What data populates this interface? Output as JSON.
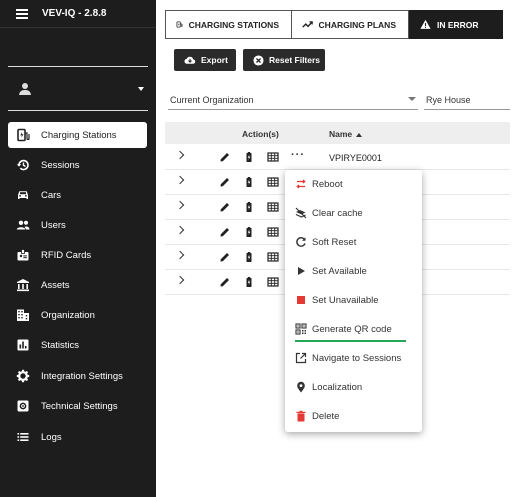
{
  "app": {
    "title": "VEV-IQ - 2.8.8"
  },
  "sidebar": {
    "items": [
      {
        "label": "Charging Stations",
        "icon": "charging-station-icon",
        "active": true
      },
      {
        "label": "Sessions",
        "icon": "history-icon"
      },
      {
        "label": "Cars",
        "icon": "car-icon"
      },
      {
        "label": "Users",
        "icon": "users-icon"
      },
      {
        "label": "RFID Cards",
        "icon": "badge-icon"
      },
      {
        "label": "Assets",
        "icon": "bank-icon"
      },
      {
        "label": "Organization",
        "icon": "building-icon"
      },
      {
        "label": "Statistics",
        "icon": "bar-chart-icon"
      },
      {
        "label": "Integration Settings",
        "icon": "settings-icon"
      },
      {
        "label": "Technical Settings",
        "icon": "settings-box-icon"
      },
      {
        "label": "Logs",
        "icon": "list-icon"
      }
    ]
  },
  "tabs": [
    {
      "label": "CHARGING STATIONS",
      "icon": "ev-station-icon",
      "active": true
    },
    {
      "label": "CHARGING PLANS",
      "icon": "trend-icon"
    },
    {
      "label": "IN ERROR",
      "icon": "warning-icon"
    }
  ],
  "toolbar": {
    "export_label": "Export",
    "reset_label": "Reset Filters"
  },
  "filters": {
    "organization_label": "Current Organization",
    "site_value": "Rye House"
  },
  "table": {
    "headers": {
      "actions": "Action(s)",
      "name": "Name"
    },
    "rows": [
      {
        "name": "VPIRYE0001"
      },
      {
        "name": ""
      },
      {
        "name": ""
      },
      {
        "name": ""
      },
      {
        "name": ""
      },
      {
        "name": ""
      }
    ]
  },
  "menu": {
    "items": [
      {
        "label": "Reboot",
        "icon": "reboot-icon"
      },
      {
        "label": "Clear cache",
        "icon": "clear-cache-icon"
      },
      {
        "label": "Soft Reset",
        "icon": "refresh-icon"
      },
      {
        "label": "Set Available",
        "icon": "play-icon"
      },
      {
        "label": "Set Unavailable",
        "icon": "stop-icon"
      },
      {
        "label": "Generate QR code",
        "icon": "qr-code-icon"
      },
      {
        "label": "Navigate to Sessions",
        "icon": "open-in-new-icon"
      },
      {
        "label": "Localization",
        "icon": "location-pin-icon"
      },
      {
        "label": "Delete",
        "icon": "trash-icon"
      }
    ]
  },
  "colors": {
    "sidebar_bg": "#1d1d1d",
    "accent_red": "#e53935",
    "highlight_green": "#26a65b"
  }
}
